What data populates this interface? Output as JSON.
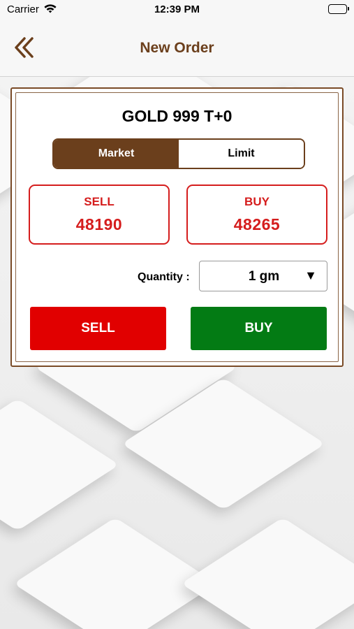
{
  "status_bar": {
    "carrier": "Carrier",
    "time": "12:39 PM"
  },
  "nav": {
    "title": "New Order",
    "back_icon": "double-chevron-left-icon"
  },
  "order": {
    "instrument": "GOLD 999 T+0",
    "order_types": [
      {
        "label": "Market",
        "selected": true
      },
      {
        "label": "Limit",
        "selected": false
      }
    ],
    "sell_quote": {
      "label": "SELL",
      "value": "48190"
    },
    "buy_quote": {
      "label": "BUY",
      "value": "48265"
    },
    "quantity_label": "Quantity :",
    "quantity_value": "1 gm",
    "dropdown_icon": "▼",
    "sell_button": "SELL",
    "buy_button": "BUY"
  },
  "colors": {
    "brand_brown": "#6b3f1c",
    "quote_red": "#d51d1d",
    "sell_red": "#e10000",
    "buy_green": "#037b14"
  }
}
